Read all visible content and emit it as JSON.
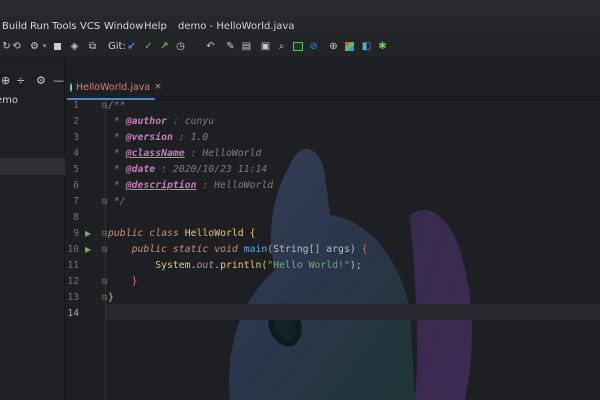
{
  "menubar": {
    "items": [
      "Build",
      "Run",
      "Tools",
      "VCS",
      "Window",
      "Help"
    ],
    "title": "demo - HelloWorld.java"
  },
  "toolbar": {
    "git_label": "Git:",
    "icons": [
      "build-icon",
      "rerun-icon",
      "run-config-icon",
      "stop-icon",
      "debug-attach-icon",
      "git-update-icon",
      "git-commit-icon",
      "git-push-icon",
      "git-history-icon",
      "git-rollback-icon",
      "settings-wrench-icon",
      "project-structure-icon",
      "layout-icon",
      "search-icon",
      "terminal-icon",
      "no-power-save-icon",
      "plugin-icon",
      "color-picker-icon",
      "code-with-me-icon",
      "puzzle-icon"
    ]
  },
  "project_panel": {
    "project_name": "emo"
  },
  "editor": {
    "tab_label": "HelloWorld.java",
    "close_glyph": "×",
    "line_numbers": [
      "1",
      "2",
      "3",
      "4",
      "5",
      "6",
      "7",
      "8",
      "9",
      "10",
      "11",
      "12",
      "13",
      "14"
    ],
    "lines": {
      "l1": "/**",
      "l2_tag": "@author",
      "l2_val": " : cunyu",
      "l3_tag": "@version",
      "l3_val": " : 1.0",
      "l4_tag": "@className",
      "l4_val": " : HelloWorld",
      "l5_tag": "@date",
      "l5_val": " : 2020/10/23 11:14",
      "l6_tag": "@description",
      "l6_val": " : HelloWorld",
      "l7": "*/",
      "l9_kw1": "public",
      "l9_kw2": "class",
      "l9_cls": "HelloWorld",
      "l9_brace": "{",
      "l10_kw1": "public",
      "l10_kw2": "static",
      "l10_kw3": "void",
      "l10_fn": "main",
      "l10_args": "(String[] args) ",
      "l10_brace": "{",
      "l11_obj": "System.",
      "l11_field": "out",
      "l11_call": ".println(",
      "l11_str": "\"Hello World!\"",
      "l11_end": ");",
      "l12": "}",
      "l13": "}"
    }
  },
  "colors": {
    "accent": "#4a88c7",
    "run_green": "#5fb85f",
    "string_green": "#6aab73",
    "keyword_orange": "#cf8e6d"
  }
}
